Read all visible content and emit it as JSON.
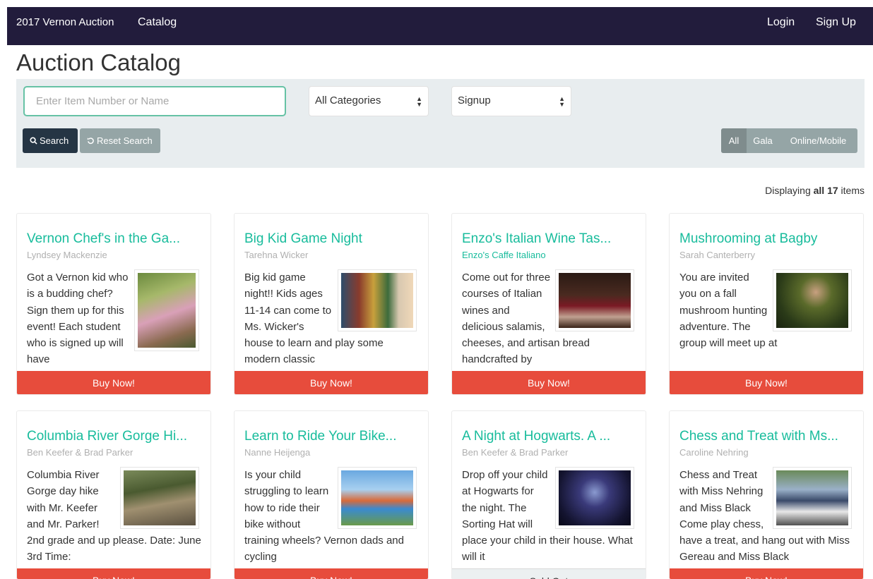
{
  "nav": {
    "brand": "2017 Vernon Auction",
    "catalog": "Catalog",
    "login": "Login",
    "signup": "Sign Up"
  },
  "page": {
    "title": "Auction Catalog"
  },
  "search": {
    "placeholder": "Enter Item Number or Name",
    "value": "",
    "category_select": "All Categories",
    "type_select": "Signup",
    "search_button": "Search",
    "reset_button": "Reset Search",
    "filters": [
      "All",
      "Gala",
      "Online/Mobile"
    ],
    "active_filter": "All"
  },
  "results": {
    "prefix": "Displaying ",
    "all_label": "all 17",
    "suffix": " items"
  },
  "items": [
    {
      "title": "Vernon Chef's in the Ga...",
      "donor": "Lyndsey Mackenzie",
      "description": "Got a Vernon kid who is a budding chef? Sign them up for this event! Each student who is signed up will have",
      "button": "Buy Now!",
      "image": "girl-photo"
    },
    {
      "title": "Big Kid Game Night",
      "donor": "Tarehna Wicker",
      "description": "Big kid game night!! Kids ages 11-14 can come to Ms. Wicker's house to learn and play some modern classic",
      "button": "Buy Now!",
      "image": "board-games-photo"
    },
    {
      "title": "Enzo's Italian Wine Tas...",
      "donor": "Enzo's Caffe Italiano",
      "description": "Come out for three courses of Italian wines and delicious salamis, cheeses, and artisan bread handcrafted by",
      "button": "Buy Now!",
      "image": "wine-glasses-photo"
    },
    {
      "title": "Mushrooming at Bagby",
      "donor": "Sarah Canterberry",
      "description": "You are invited you on a fall mushroom hunting adventure. The group will meet up at",
      "button": "Buy Now!",
      "image": "forest-photo"
    },
    {
      "title": "Columbia River Gorge Hi...",
      "donor": "Ben Keefer & Brad Parker",
      "description": "Columbia River Gorge day hike with Mr. Keefer and Mr. Parker! 2nd grade and up please. Date: June 3rd Time:",
      "button": "Buy Now!",
      "image": "hike-photo"
    },
    {
      "title": "Learn to Ride Your Bike...",
      "donor": "Nanne Heijenga",
      "description": "Is your child struggling to learn how to ride their bike without training wheels? Vernon dads and cycling",
      "button": "Buy Now!",
      "image": "kids-bikes-photo"
    },
    {
      "title": "A Night at Hogwarts. A ...",
      "donor": "Ben Keefer & Brad Parker",
      "description": "Drop off your child at Hogwarts for the night. The Sorting Hat will place your child in their house. What will it",
      "button": "Sold Out",
      "image": "hogwarts-photo"
    },
    {
      "title": "Chess and Treat with Ms...",
      "donor": "Caroline Nehring",
      "description": "Chess and Treat with Miss Nehring and Miss Black Come play chess, have a treat, and hang out with Miss Gereau and Miss Black",
      "button": "Buy Now!",
      "image": "chess-photo"
    }
  ],
  "colors": {
    "navbar": "#221c3c",
    "accent": "#18bc9c",
    "buy_button": "#e74c3c",
    "search_button": "#253544",
    "reset_button": "#95a5a6"
  }
}
